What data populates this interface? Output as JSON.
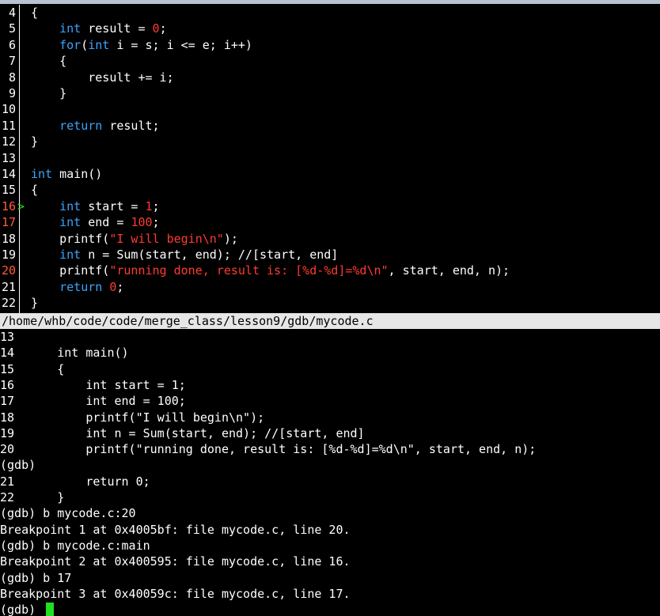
{
  "source": {
    "lines": [
      {
        "n": "4",
        "code": "{",
        "bp": false
      },
      {
        "n": "5",
        "code": "    int result = 0;",
        "bp": false
      },
      {
        "n": "6",
        "code": "    for(int i = s; i <= e; i++)",
        "bp": false
      },
      {
        "n": "7",
        "code": "    {",
        "bp": false
      },
      {
        "n": "8",
        "code": "        result += i;",
        "bp": false
      },
      {
        "n": "9",
        "code": "    }",
        "bp": false
      },
      {
        "n": "10",
        "code": "",
        "bp": false
      },
      {
        "n": "11",
        "code": "    return result;",
        "bp": false
      },
      {
        "n": "12",
        "code": "}",
        "bp": false
      },
      {
        "n": "13",
        "code": "",
        "bp": false
      },
      {
        "n": "14",
        "code": "int main()",
        "bp": false
      },
      {
        "n": "15",
        "code": "{",
        "bp": false
      },
      {
        "n": "16",
        "code": "    int start = 1;",
        "bp": true,
        "marker": ">"
      },
      {
        "n": "17",
        "code": "    int end = 100;",
        "bp": true
      },
      {
        "n": "18",
        "code": "    printf(\"I will begin\\n\");",
        "bp": false
      },
      {
        "n": "19",
        "code": "    int n = Sum(start, end); //[start, end]",
        "bp": false
      },
      {
        "n": "20",
        "code": "    printf(\"running done, result is: [%d-%d]=%d\\n\", start, end, n);",
        "bp": true
      },
      {
        "n": "21",
        "code": "    return 0;",
        "bp": false
      },
      {
        "n": "22",
        "code": "}",
        "bp": false
      }
    ]
  },
  "status_bar": {
    "path": "/home/whb/code/code/merge_class/lesson9/gdb/mycode.c"
  },
  "console": {
    "lines": [
      "13",
      "14      int main()",
      "15      {",
      "16          int start = 1;",
      "17          int end = 100;",
      "18          printf(\"I will begin\\n\");",
      "19          int n = Sum(start, end); //[start, end]",
      "20          printf(\"running done, result is: [%d-%d]=%d\\n\", start, end, n);",
      "(gdb)",
      "21          return 0;",
      "22      }",
      "(gdb) b mycode.c:20",
      "Breakpoint 1 at 0x4005bf: file mycode.c, line 20.",
      "(gdb) b mycode.c:main",
      "Breakpoint 2 at 0x400595: file mycode.c, line 16.",
      "(gdb) b 17",
      "Breakpoint 3 at 0x40059c: file mycode.c, line 17.",
      "(gdb) "
    ]
  },
  "colors": {
    "keyword": "#3aa5ff",
    "literal": "#ff3b30",
    "breakpoint_line_number": "#ff5a3c",
    "current_line_marker": "#20e020",
    "cursor": "#20e020",
    "status_bar_bg": "#e6e6e6"
  }
}
